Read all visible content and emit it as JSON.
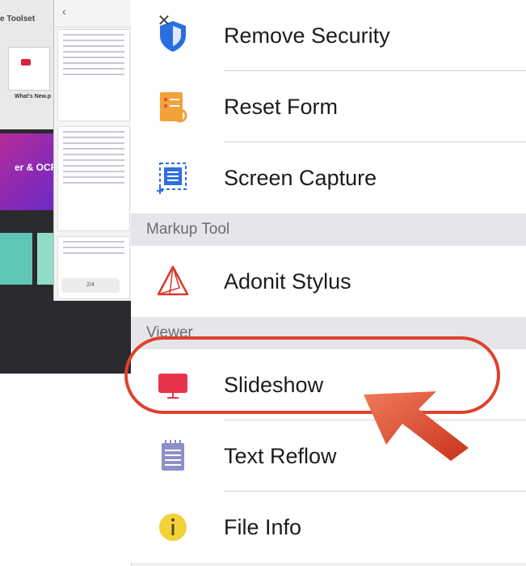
{
  "background_app": {
    "toolset_label": "e Toolset",
    "whats_new_label": "What's New.p",
    "ocr_label": "er & OCR",
    "pager_label": "2/4"
  },
  "menu": {
    "items": [
      {
        "label": "Remove Security",
        "icon": "shield-icon"
      },
      {
        "label": "Reset Form",
        "icon": "reset-form-icon"
      },
      {
        "label": "Screen Capture",
        "icon": "screen-capture-icon"
      }
    ],
    "sections": [
      {
        "title": "Markup Tool",
        "items": [
          {
            "label": "Adonit Stylus",
            "icon": "stylus-icon"
          }
        ]
      },
      {
        "title": "Viewer",
        "items": [
          {
            "label": "Slideshow",
            "icon": "slideshow-icon"
          },
          {
            "label": "Text Reflow",
            "icon": "text-reflow-icon"
          },
          {
            "label": "File Info",
            "icon": "info-icon"
          }
        ]
      }
    ]
  },
  "colors": {
    "shield_blue": "#2a6fe0",
    "form_orange": "#f1a23b",
    "capture_blue": "#2f6fe0",
    "stylus_red": "#d93a2b",
    "slideshow_red": "#e8344a",
    "reflow_purple": "#8e8fc9",
    "info_yellow": "#f2d13a",
    "highlight_red": "#e0402e"
  }
}
